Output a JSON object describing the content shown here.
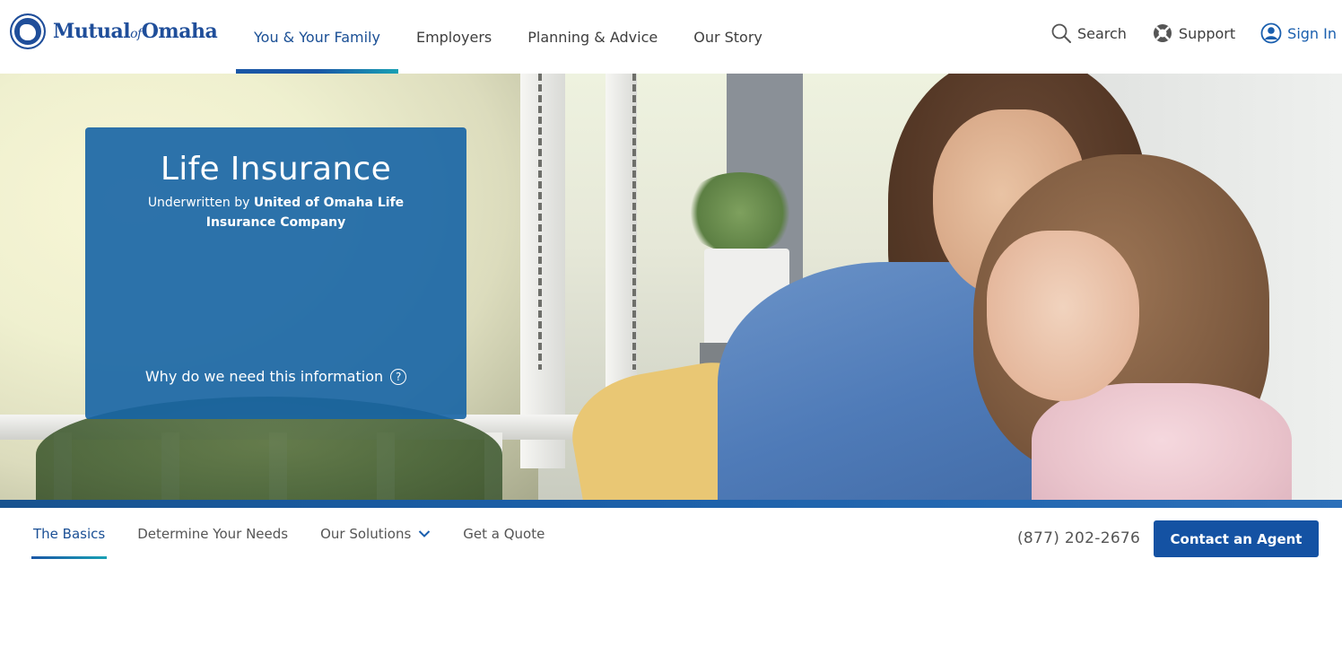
{
  "brand": {
    "name_part1": "Mutual",
    "name_of": "of",
    "name_part2": "Omaha",
    "color": "#1f4e9a"
  },
  "main_nav": {
    "items": [
      {
        "label": "You & Your Family",
        "active": true
      },
      {
        "label": "Employers",
        "active": false
      },
      {
        "label": "Planning & Advice",
        "active": false
      },
      {
        "label": "Our Story",
        "active": false
      }
    ]
  },
  "util_nav": {
    "search": {
      "label": "Search",
      "icon": "search-icon"
    },
    "support": {
      "label": "Support",
      "icon": "lifebuoy-icon"
    },
    "signin": {
      "label": "Sign In",
      "icon": "user-circle-icon"
    }
  },
  "hero": {
    "title": "Life Insurance",
    "underwritten_prefix": "Underwritten by",
    "underwritten_company": "United of Omaha Life Insurance Company",
    "why_link": "Why do we need this information",
    "help_icon_glyph": "?",
    "card_color": "#1664a5"
  },
  "sub_nav": {
    "tabs": [
      {
        "label": "The Basics",
        "active": true
      },
      {
        "label": "Determine Your Needs",
        "active": false
      },
      {
        "label": "Our Solutions",
        "active": false,
        "dropdown": true
      },
      {
        "label": "Get a Quote",
        "active": false
      }
    ],
    "phone": "(877) 202-2676",
    "cta_label": "Contact an Agent",
    "cta_color": "#1452a3"
  }
}
